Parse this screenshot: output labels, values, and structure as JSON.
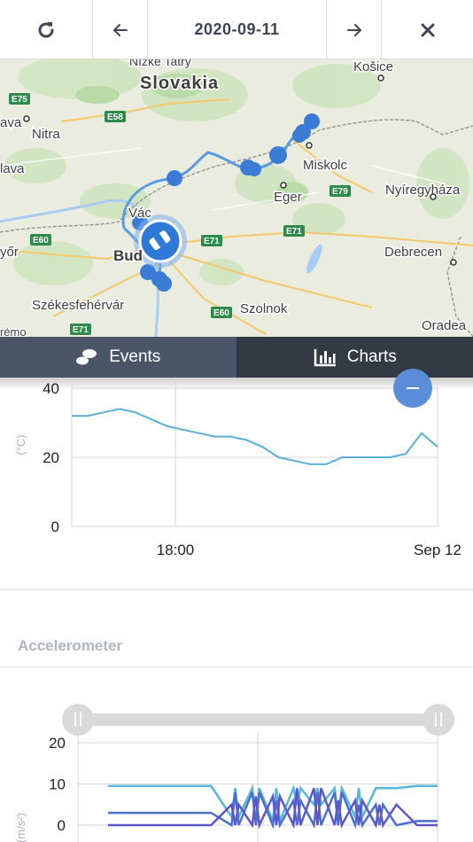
{
  "toolbar": {
    "date": "2020-09-11"
  },
  "map": {
    "labels": {
      "nizke_tatry": "Nízke Tatry",
      "slovakia": "Slovakia",
      "kosice": "Košice",
      "e75": "E75",
      "e58": "E58",
      "nitra": "Nitra",
      "ava": "ava",
      "lava": "lava",
      "miskolc": "Miskolc",
      "eger": "Eger",
      "e79": "E79",
      "nyiregyhaza": "Nyíregyháza",
      "vac": "Vác",
      "e60_left": "E60",
      "e71_right": "E71",
      "e71_mid": "E71",
      "gyor": "yőr",
      "buda": "Bud",
      "debrecen": "Debrecen",
      "szekesfehervar": "Székesfehérvár",
      "e60_bottom": "E60",
      "szolnok": "Szolnok",
      "veszprem": "rémo",
      "e71_bottom": "E71",
      "oradea": "Oradea"
    }
  },
  "tabs": {
    "events": "Events",
    "charts": "Charts"
  },
  "temperature_chart": {
    "y_ticks": [
      "40",
      "20",
      "0"
    ],
    "y_label": "(°C)",
    "x_ticks": [
      "18:00",
      "Sep 12"
    ]
  },
  "accelerometer": {
    "title": "Accelerometer",
    "y_ticks": [
      "20",
      "10",
      "0"
    ],
    "y_label": "(m/s²)"
  },
  "chart_data": [
    {
      "type": "line",
      "ylabel": "(°C)",
      "ylim": [
        0,
        40
      ],
      "x_ticks": [
        "18:00",
        "Sep 12"
      ],
      "series": [
        {
          "values": [
            32,
            32,
            33,
            34,
            33,
            31,
            29,
            28,
            27,
            26,
            26,
            25,
            23,
            20,
            19,
            18,
            18,
            20,
            20,
            20,
            20,
            21,
            27,
            23
          ]
        }
      ],
      "grid": true
    },
    {
      "type": "line",
      "ylabel": "(m/s²)",
      "ylim": [
        -2,
        20
      ],
      "y_ticks": [
        20,
        10,
        0
      ],
      "series": [
        {
          "values": [
            9.5,
            9.5,
            9.5,
            9.5,
            9.5,
            9.5,
            2,
            9,
            1,
            9,
            5,
            9,
            2,
            9,
            9,
            9.5,
            9.5
          ]
        },
        {
          "values": [
            3,
            3,
            3,
            3,
            3,
            3,
            0,
            8,
            0,
            6,
            0,
            8,
            0,
            5,
            0,
            1,
            1
          ]
        },
        {
          "values": [
            0,
            0,
            0,
            0,
            0,
            0,
            5,
            0,
            7,
            0,
            9,
            0,
            6,
            0,
            5,
            0,
            0
          ]
        }
      ],
      "grid": true
    }
  ]
}
